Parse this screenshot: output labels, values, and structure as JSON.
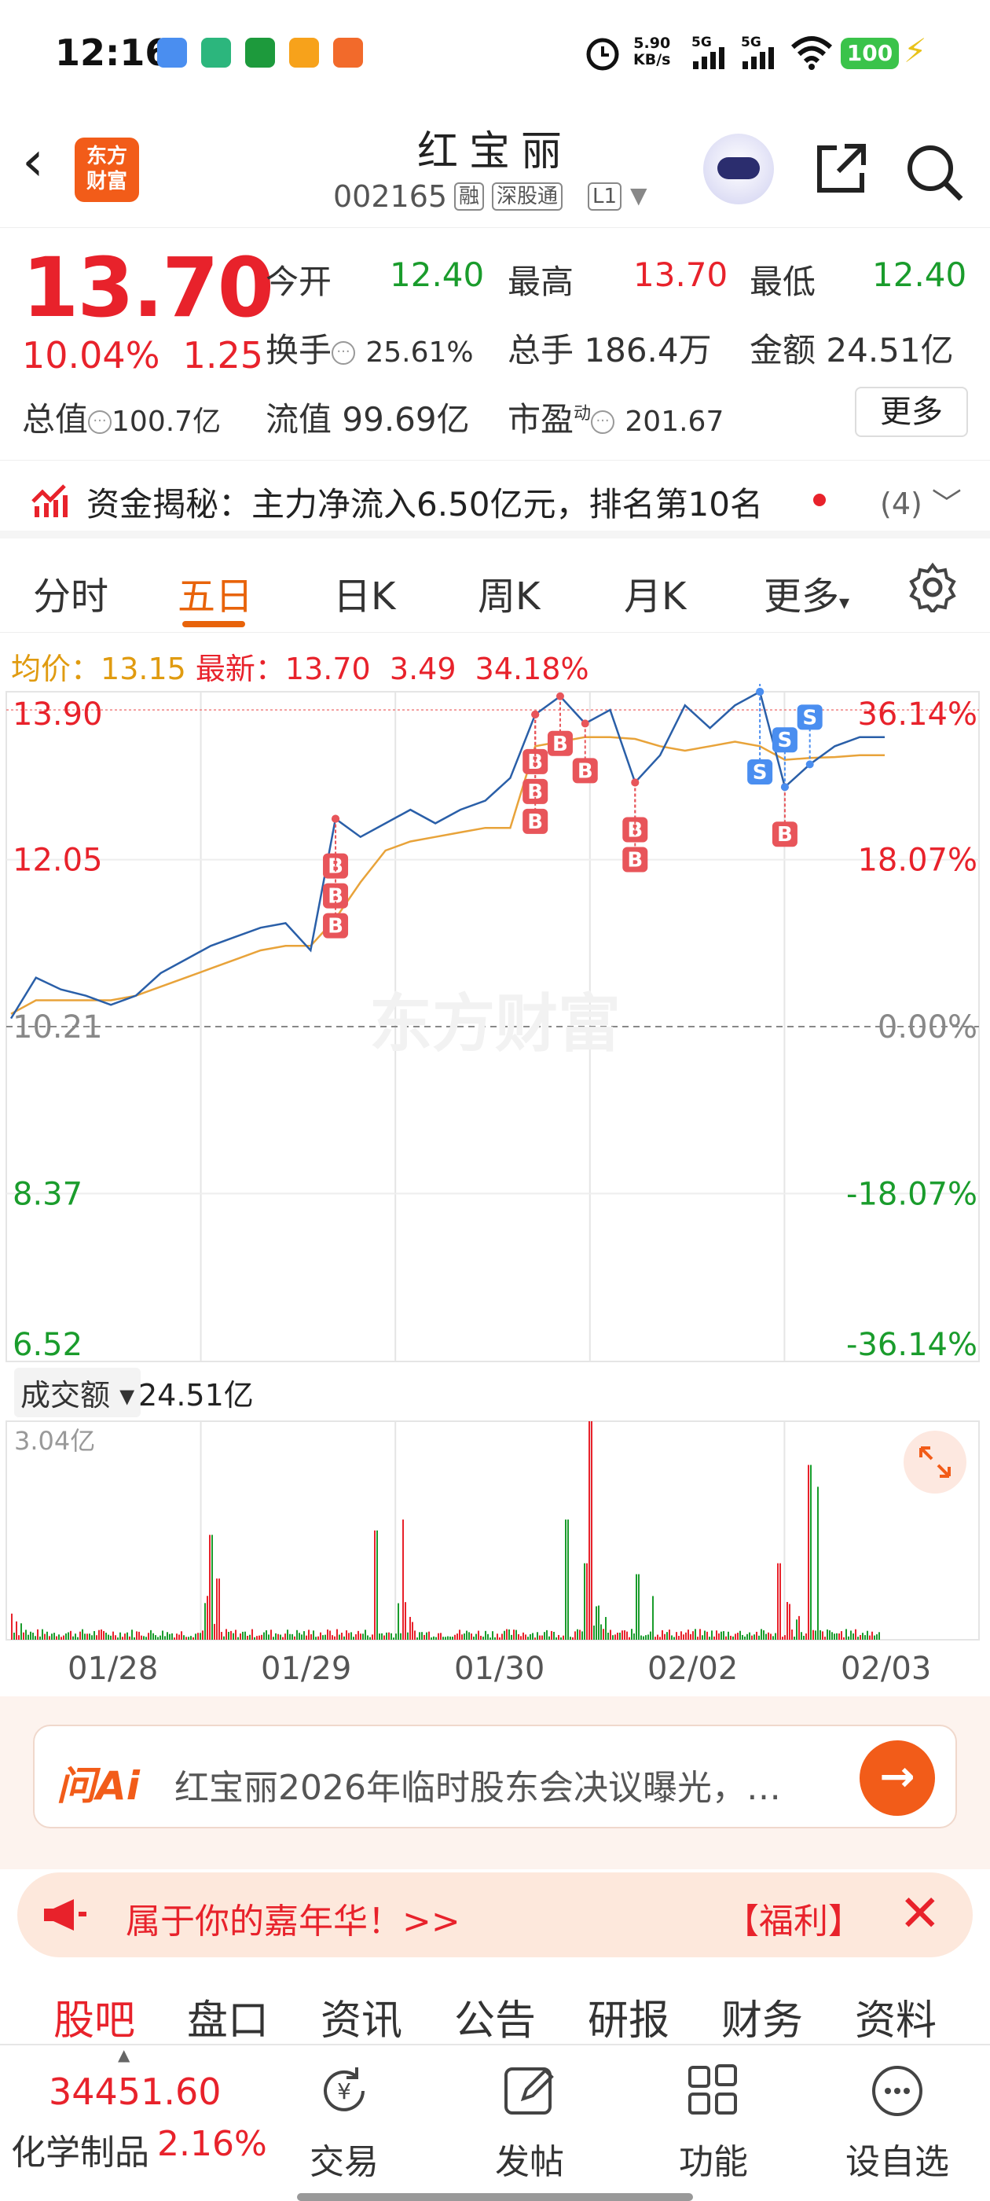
{
  "status": {
    "time": "12:16",
    "net_speed_top": "5.90",
    "net_speed_unit": "KB/s",
    "sig1": "5G",
    "sig2": "5G",
    "battery": "100"
  },
  "header": {
    "name": "红宝丽",
    "code": "002165",
    "tags": [
      "融",
      "深股通",
      "L1"
    ]
  },
  "quote": {
    "price": "13.70",
    "pct": "10.04%",
    "chg": "1.25",
    "open_label": "今开",
    "open": "12.40",
    "high_label": "最高",
    "high": "13.70",
    "low_label": "最低",
    "low": "12.40",
    "turnover_label": "换手",
    "turnover": "25.61%",
    "vol_label": "总手",
    "vol": "186.4万",
    "amount_label": "金额",
    "amount": "24.51亿",
    "mcap_label": "总值",
    "mcap": "100.7亿",
    "float_label": "流值",
    "float": "99.69亿",
    "pe_label": "市盈",
    "pe_sup": "动",
    "pe": "201.67",
    "more": "更多"
  },
  "fund": {
    "text": "资金揭秘：主力净流入6.50亿元，排名第10名",
    "count": "(4)"
  },
  "tabs": [
    "分时",
    "五日",
    "日K",
    "周K",
    "月K",
    "更多"
  ],
  "active_tab": "五日",
  "info": {
    "avg_label": "均价：",
    "avg": "13.15",
    "latest_label": "最新：",
    "latest": "13.70",
    "chg": "3.49",
    "pct": "34.18%"
  },
  "chart_data": {
    "type": "line",
    "price_axis": [
      "13.90",
      "12.05",
      "10.21",
      "8.37",
      "6.52"
    ],
    "pct_axis": [
      "36.14%",
      "18.07%",
      "0.00%",
      "-18.07%",
      "-36.14%"
    ],
    "x": [
      "01/28",
      "01/29",
      "01/30",
      "02/02",
      "02/03"
    ],
    "series": [
      {
        "values": [
          10.3,
          10.75,
          10.62,
          10.55,
          10.45,
          10.55,
          10.8,
          10.95,
          11.1,
          11.2,
          11.3,
          11.35,
          11.05,
          12.5,
          12.3,
          12.45,
          12.6,
          12.45,
          12.6,
          12.7,
          12.95,
          13.65,
          13.85,
          13.55,
          13.7,
          12.9,
          13.2,
          13.75,
          13.5,
          13.75,
          13.9,
          12.85,
          13.1,
          13.3,
          13.4,
          13.4
        ]
      },
      {
        "name": "均价",
        "values": [
          10.35,
          10.5,
          10.5,
          10.5,
          10.5,
          10.55,
          10.65,
          10.75,
          10.85,
          10.95,
          11.05,
          11.1,
          11.1,
          11.4,
          11.8,
          12.15,
          12.25,
          12.3,
          12.35,
          12.4,
          12.4,
          13.3,
          13.35,
          13.4,
          13.4,
          13.38,
          13.3,
          13.25,
          13.3,
          13.35,
          13.3,
          13.15,
          13.17,
          13.18,
          13.2,
          13.2
        ]
      }
    ],
    "volume_label": "成交额",
    "volume_total": "24.51亿",
    "volume_max": "3.04亿",
    "watermark": "东方财富"
  },
  "ai": {
    "logo": "问Ai",
    "text": "红宝丽2026年临时股东会决议曝光，…"
  },
  "promo": {
    "text": "属于你的嘉年华！>>",
    "tag": "【福利】"
  },
  "bottom_tabs": [
    "股吧",
    "盘口",
    "资讯",
    "公告",
    "研报",
    "财务",
    "资料"
  ],
  "index": {
    "value": "34451.60",
    "name": "化学制品",
    "pct": "2.16%"
  },
  "nav": [
    "交易",
    "发帖",
    "功能",
    "设自选"
  ]
}
